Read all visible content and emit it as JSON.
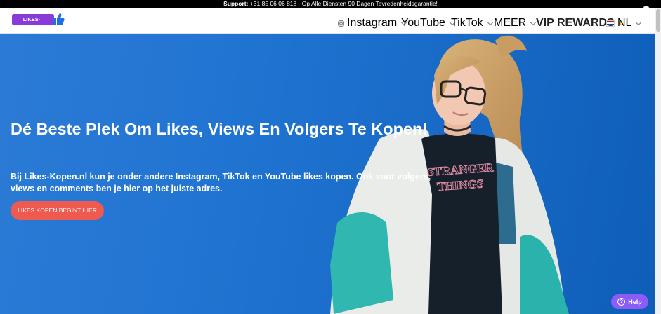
{
  "topbar": {
    "support_label": "Support:",
    "support_text": " +31 85 06 06 818 - Op Alle Diensten 90 Dagen Tevredenheidsgarantie!"
  },
  "logo": {
    "text": "LIKES-KOPEN.NL"
  },
  "nav": {
    "instagram": "Instagram",
    "youtube": "YouTube",
    "tiktok": "TikTok",
    "meer": "MEER",
    "vip": "VIP REWARDS",
    "language": "NL"
  },
  "hero": {
    "title": "Dé Beste Plek Om Likes, Views En Volgers Te Kopen!",
    "subtitle": "Bij Likes-Kopen.nl kun je onder andere Instagram, TikTok en YouTube likes kopen. Ook voor volgers, views en comments ben je hier op het juiste adres.",
    "cta": "LIKES KOPEN BEGINT HIER",
    "shirt_text_1": "STRANGER",
    "shirt_text_2": "THINGS"
  },
  "help": {
    "label": "Help"
  },
  "colors": {
    "hero_bg": "#1f73d0",
    "cta": "#ee5a4f",
    "logo": "#8a3ad8",
    "help": "#8b5cf6"
  }
}
